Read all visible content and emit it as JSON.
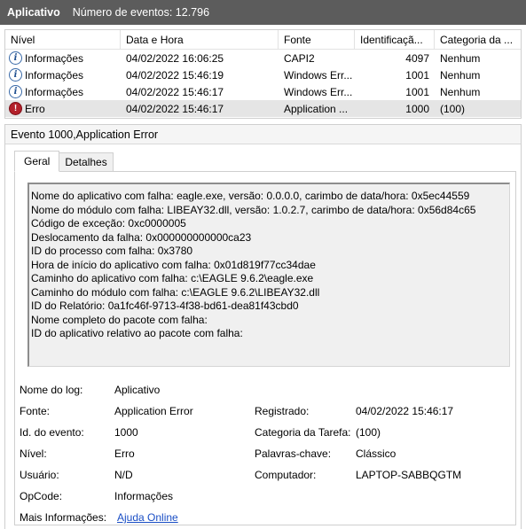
{
  "title_bar": {
    "app": "Aplicativo",
    "count": "Número de eventos: 12.796"
  },
  "list": {
    "columns": [
      "Nível",
      "Data e Hora",
      "Fonte",
      "Identificaçã...",
      "Categoria da ..."
    ],
    "rows": [
      {
        "level": "Informações",
        "icon": "info-icon",
        "datetime": "04/02/2022 16:06:25",
        "source": "CAPI2",
        "id": "4097",
        "category": "Nenhum"
      },
      {
        "level": "Informações",
        "icon": "info-icon",
        "datetime": "04/02/2022 15:46:19",
        "source": "Windows Err...",
        "id": "1001",
        "category": "Nenhum"
      },
      {
        "level": "Informações",
        "icon": "info-icon",
        "datetime": "04/02/2022 15:46:17",
        "source": "Windows Err...",
        "id": "1001",
        "category": "Nenhum"
      },
      {
        "level": "Erro",
        "icon": "error-icon",
        "datetime": "04/02/2022 15:46:17",
        "source": "Application ...",
        "id": "1000",
        "category": "(100)"
      }
    ]
  },
  "detail": {
    "title": "Evento 1000,Application Error",
    "tabs": [
      "Geral",
      "Detalhes"
    ],
    "description": [
      "Nome do aplicativo com falha: eagle.exe, versão: 0.0.0.0, carimbo de data/hora: 0x5ec44559",
      "Nome do módulo com falha: LIBEAY32.dll, versão: 1.0.2.7, carimbo de data/hora: 0x56d84c65",
      "Código de exceção: 0xc0000005",
      "Deslocamento da falha: 0x000000000000ca23",
      "ID do processo com falha: 0x3780",
      "Hora de início do aplicativo com falha: 0x01d819f77cc34dae",
      "Caminho do aplicativo com falha: c:\\EAGLE 9.6.2\\eagle.exe",
      "Caminho do módulo com falha: c:\\EAGLE 9.6.2\\LIBEAY32.dll",
      "ID do Relatório: 0a1fc46f-9713-4f38-bd61-dea81f43cbd0",
      "Nome completo do pacote com falha:",
      "ID do aplicativo relativo ao pacote com falha:"
    ],
    "props": {
      "log_name_label": "Nome do log:",
      "log_name": "Aplicativo",
      "source_label": "Fonte:",
      "source": "Application Error",
      "logged_label": "Registrado:",
      "logged": "04/02/2022 15:46:17",
      "event_id_label": "Id. do evento:",
      "event_id": "1000",
      "task_label": "Categoria da Tarefa:",
      "task": "(100)",
      "level_label": "Nível:",
      "level": "Erro",
      "keywords_label": "Palavras-chave:",
      "keywords": "Clássico",
      "user_label": "Usuário:",
      "user": "N/D",
      "computer_label": "Computador:",
      "computer": "LAPTOP-SABBQGTM",
      "opcode_label": "OpCode:",
      "opcode": "Informações",
      "more_info_label": "Mais Informações:",
      "more_info_link": "Ajuda Online"
    }
  }
}
